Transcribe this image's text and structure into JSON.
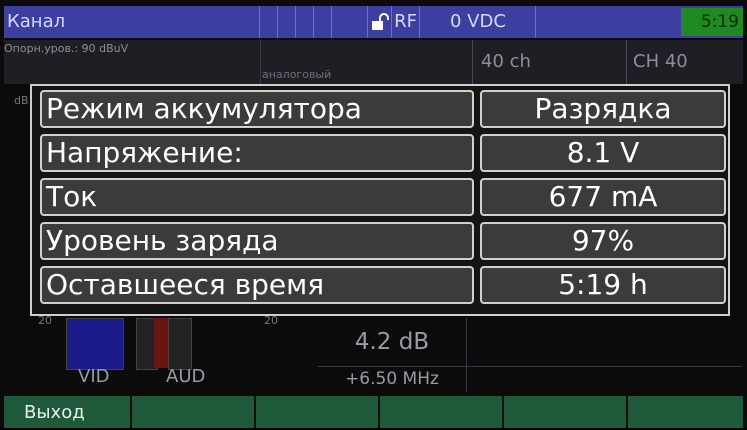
{
  "topbar": {
    "title": "Канал",
    "rf_label": "RF",
    "voltage": "0 VDC",
    "battery_time": "5:19"
  },
  "header": {
    "ref_level": "Опорн.уров.: 90 dBuV",
    "mode": "аналоговый",
    "channel": "40 ch",
    "channel_name": "CH 40",
    "db_label": "dB"
  },
  "background": {
    "scale_left": "20",
    "scale_right": "20",
    "vid_label": "VID",
    "aud_label": "AUD",
    "cn_value": "4.2 dB",
    "offset_value": "+6.50 MHz"
  },
  "battery_dialog": {
    "rows": [
      {
        "label": "Режим аккумулятора",
        "value": "Разрядка"
      },
      {
        "label": "Напряжение:",
        "value": "8.1 V"
      },
      {
        "label": "Ток",
        "value": "677 mA"
      },
      {
        "label": "Уровень заряда",
        "value": "97%"
      },
      {
        "label": "Оставшееся время",
        "value": "5:19 h"
      }
    ]
  },
  "function_keys": [
    "Выход",
    "",
    "",
    "",
    "",
    ""
  ]
}
